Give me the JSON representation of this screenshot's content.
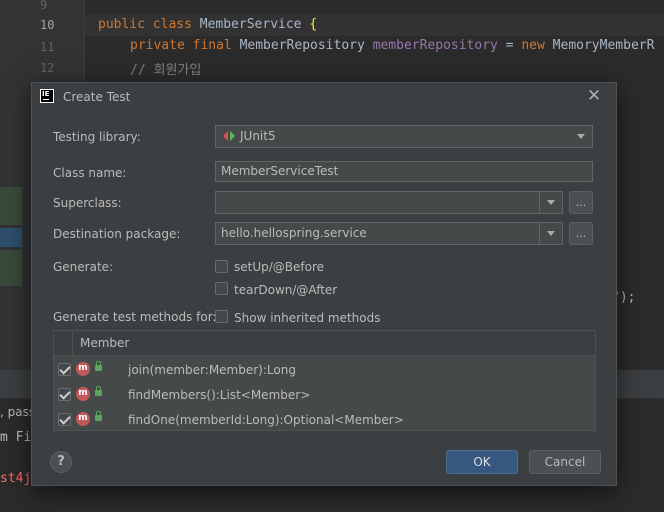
{
  "editor": {
    "line_numbers": [
      "9",
      "10",
      "11",
      "12"
    ],
    "code_line_10": {
      "kw": "public class ",
      "name": "MemberService ",
      "brace": "{"
    },
    "code_line_11": {
      "kw1": "private final ",
      "type": "MemberRepository ",
      "field": "memberRepository",
      "eq": " = ",
      "kw2": "new ",
      "rest": "MemoryMemberR"
    },
    "code_line_12": "// 회원가입",
    "code_fragment": "\");",
    "side_text_1": ", passe",
    "side_text_2": "m Fi",
    "side_text_3": "st4j"
  },
  "dialog": {
    "title": "Create Test",
    "testing_library_label": "Testing library:",
    "testing_library_value": "JUnit5",
    "class_name_label": "Class name:",
    "class_name_value": "MemberServiceTest",
    "superclass_label": "Superclass:",
    "superclass_value": "",
    "destination_label": "Destination package:",
    "destination_value": "hello.hellospring.service",
    "browse_label": "...",
    "generate_label": "Generate:",
    "setup_label": "setUp/@Before",
    "teardown_label": "tearDown/@After",
    "methods_for_label": "Generate test methods for:",
    "show_inherited_label": "Show inherited methods",
    "table_header": "Member",
    "methods": [
      {
        "icon": "m",
        "label": "join(member:Member):Long"
      },
      {
        "icon": "m",
        "label": "findMembers():List<Member>"
      },
      {
        "icon": "m",
        "label": "findOne(memberId:Long):Optional<Member>"
      }
    ],
    "help_label": "?",
    "ok_label": "OK",
    "cancel_label": "Cancel"
  },
  "colors": {
    "dialog_bg": "#3c3f41",
    "ok_button": "#365880",
    "method_icon": "#c05a5a"
  }
}
